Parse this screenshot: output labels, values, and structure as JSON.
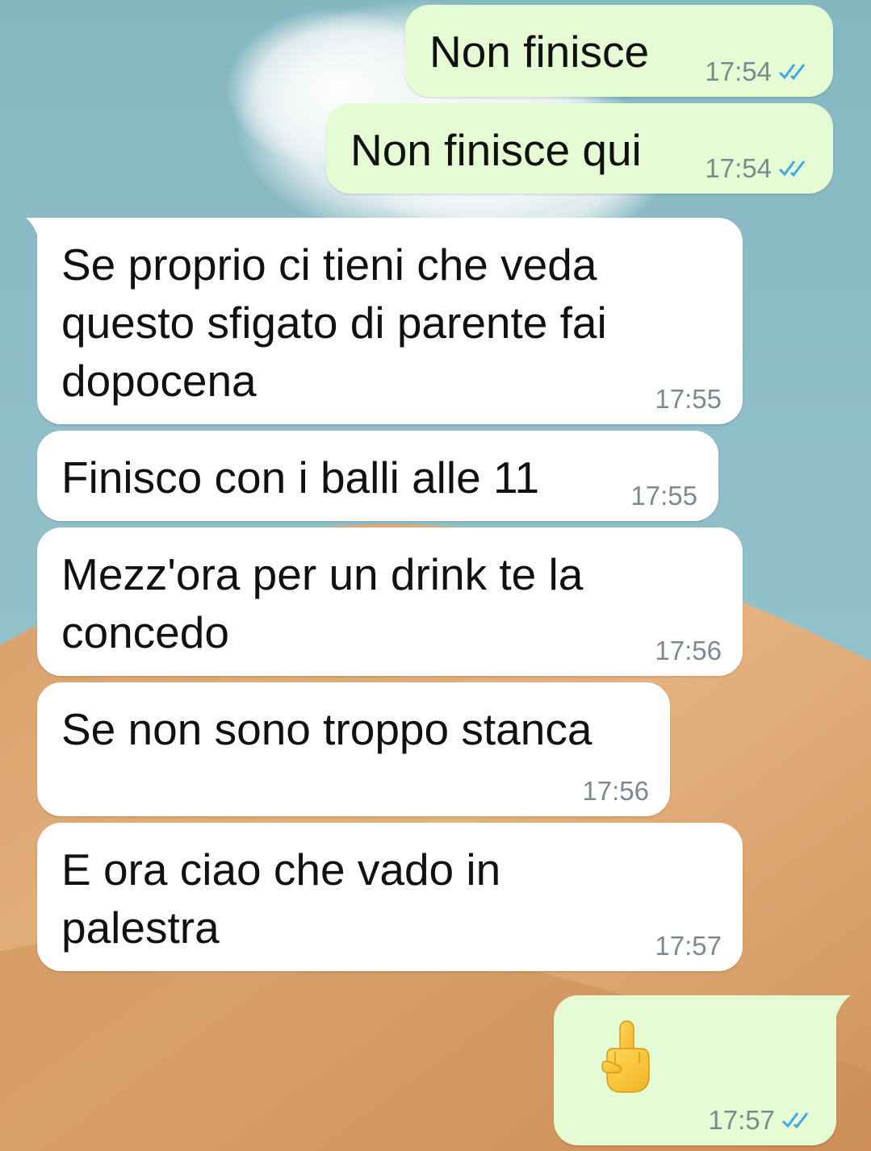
{
  "colors": {
    "incoming_bubble": "#ffffff",
    "outgoing_bubble": "#e5fbd4",
    "read_ticks": "#3fa9e8",
    "time_text": "#7c8a8f"
  },
  "messages": [
    {
      "text": "Non finisce",
      "time": "17:54",
      "direction": "outgoing",
      "status": "read"
    },
    {
      "text": "Non finisce qui",
      "time": "17:54",
      "direction": "outgoing",
      "status": "read"
    },
    {
      "text": "Se proprio ci tieni che veda\nquesto sfigato di parente fai\ndopocena",
      "time": "17:55",
      "direction": "incoming"
    },
    {
      "text": "Finisco con i balli alle 11",
      "time": "17:55",
      "direction": "incoming"
    },
    {
      "text": "Mezz'ora per un drink te la\nconcedo",
      "time": "17:56",
      "direction": "incoming"
    },
    {
      "text": "Se non sono troppo stanca",
      "time": "17:56",
      "direction": "incoming"
    },
    {
      "text": "E ora ciao che vado in\npalestra",
      "time": "17:57",
      "direction": "incoming"
    },
    {
      "text": "",
      "emoji": "middle-finger-emoji",
      "time": "17:57",
      "direction": "outgoing",
      "status": "read"
    }
  ]
}
